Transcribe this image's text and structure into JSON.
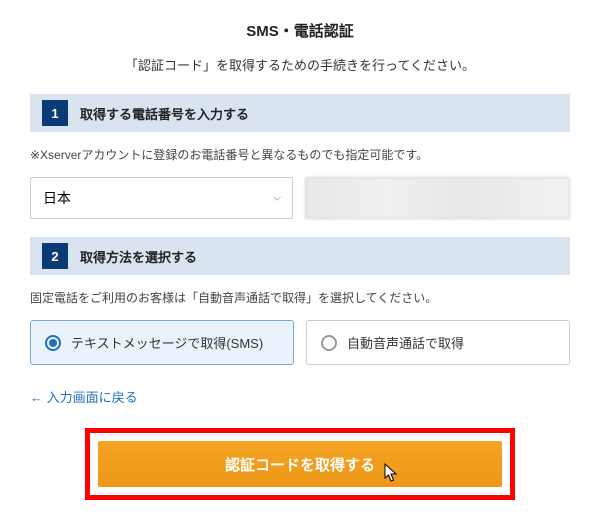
{
  "header": {
    "title": "SMS・電話認証",
    "subtitle": "「認証コード」を取得するための手続きを行ってください。"
  },
  "section1": {
    "number": "1",
    "title": "取得する電話番号を入力する",
    "note": "※Xserverアカウントに登録のお電話番号と異なるものでも指定可能です。",
    "country_selected": "日本"
  },
  "section2": {
    "number": "2",
    "title": "取得方法を選択する",
    "note": "固定電話をご利用のお客様は「自動音声通話で取得」を選択してください。",
    "option_sms": "テキストメッセージで取得(SMS)",
    "option_voice": "自動音声通話で取得"
  },
  "back_link": "← 入力画面に戻る",
  "submit_button": "認証コードを取得する"
}
